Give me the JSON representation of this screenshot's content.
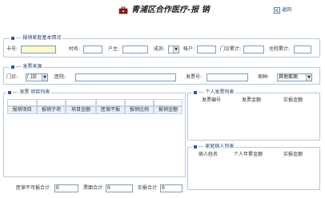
{
  "header": {
    "title": "青浦区合作医疗-报 销",
    "back_label": "返回"
  },
  "basic_info": {
    "legend": "--- 报销家庭基本情况",
    "card_label": "卡号:",
    "card_value": "",
    "village_label": "村名:",
    "householder_label": "户主:",
    "member_label": "成员:",
    "account_label": "帐户:",
    "outpatient_total_label": "门诊累计:",
    "inpatient_total_label": "住院累计:"
  },
  "invoice_source": {
    "legend": "--- 发票来源",
    "clinic_label": "门诊:",
    "clinic_value": "门诊",
    "hospital_label": "医院:",
    "invoice_no_label": "发票号:",
    "disease_label": "病种:",
    "disease_value": "其他疾病"
  },
  "invoice_items": {
    "legend": "--- 发票 项目列表",
    "columns": [
      "报销项目",
      "报销子项",
      "项目金额",
      "医保不报",
      "报销比例",
      "报销金额"
    ]
  },
  "personal_invoices": {
    "legend": "--- 个人发票列表",
    "columns": [
      "发票编号",
      "发票金额",
      "实报金额"
    ]
  },
  "family_patients": {
    "legend": "--- 家庭病人列表",
    "columns": [
      "病人姓名",
      "个人年累金额",
      "实报金额"
    ]
  },
  "totals": {
    "non_reimbursable_label": "医保不可报合计",
    "non_reimbursable_value": "0",
    "invoice_total_label": "票面合计",
    "invoice_total_value": "0",
    "actual_total_label": "实报合计",
    "actual_total_value": "0"
  },
  "colors": {
    "border": "#b8c8dc",
    "accent": "#2a58a8",
    "header_cell": "#e8f0fa",
    "card_input": "#fff8c8"
  }
}
